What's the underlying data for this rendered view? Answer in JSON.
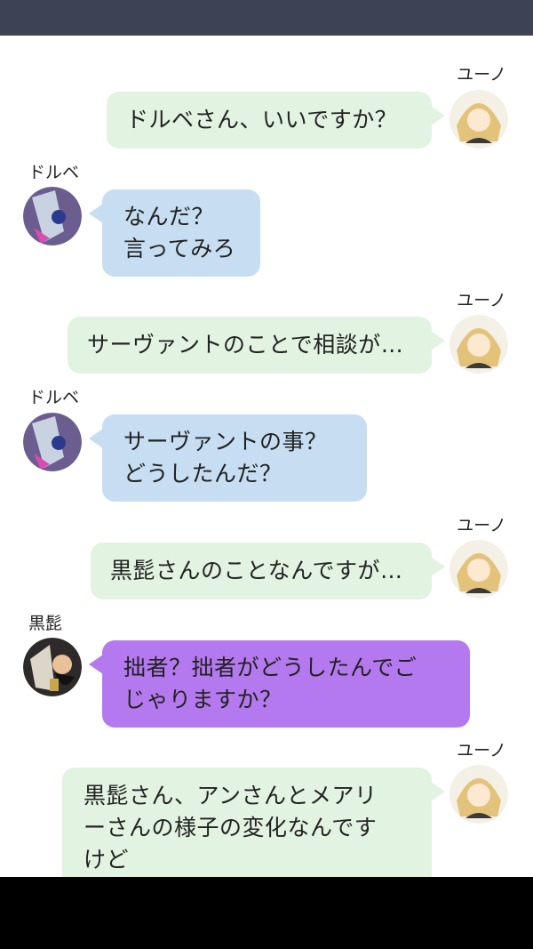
{
  "messages": [
    {
      "sender": "ユーノ",
      "side": "right",
      "color": "#e2f3e1",
      "avatar_icon": "yuno-avatar-icon",
      "lines": [
        "ドルベさん、いいですか？"
      ]
    },
    {
      "sender": "ドルベ",
      "side": "left",
      "color": "#c6ddf2",
      "avatar_icon": "dorube-avatar-icon",
      "lines": [
        "なんだ？",
        "言ってみろ"
      ]
    },
    {
      "sender": "ユーノ",
      "side": "right",
      "color": "#e2f3e1",
      "avatar_icon": "yuno-avatar-icon",
      "lines": [
        "サーヴァントのことで相談が…"
      ]
    },
    {
      "sender": "ドルベ",
      "side": "left",
      "color": "#c6ddf2",
      "avatar_icon": "dorube-avatar-icon",
      "lines": [
        "サーヴァントの事？",
        "どうしたんだ？"
      ]
    },
    {
      "sender": "ユーノ",
      "side": "right",
      "color": "#e2f3e1",
      "avatar_icon": "yuno-avatar-icon",
      "lines": [
        "黒髭さんのことなんですが…"
      ]
    },
    {
      "sender": "黒髭",
      "side": "left",
      "color": "#b479ef",
      "avatar_icon": "kurohige-avatar-icon",
      "lines": [
        "拙者？拙者がどうしたんでご",
        "じゃりますか？"
      ]
    },
    {
      "sender": "ユーノ",
      "side": "right",
      "color": "#e2f3e1",
      "avatar_icon": "yuno-avatar-icon",
      "lines": [
        "黒髭さん、アンさんとメアリ",
        "ーさんの様子の変化なんです",
        "けど"
      ]
    }
  ],
  "colors": {
    "status_bar": "#3d4254",
    "navigation_bar": "#000000"
  }
}
